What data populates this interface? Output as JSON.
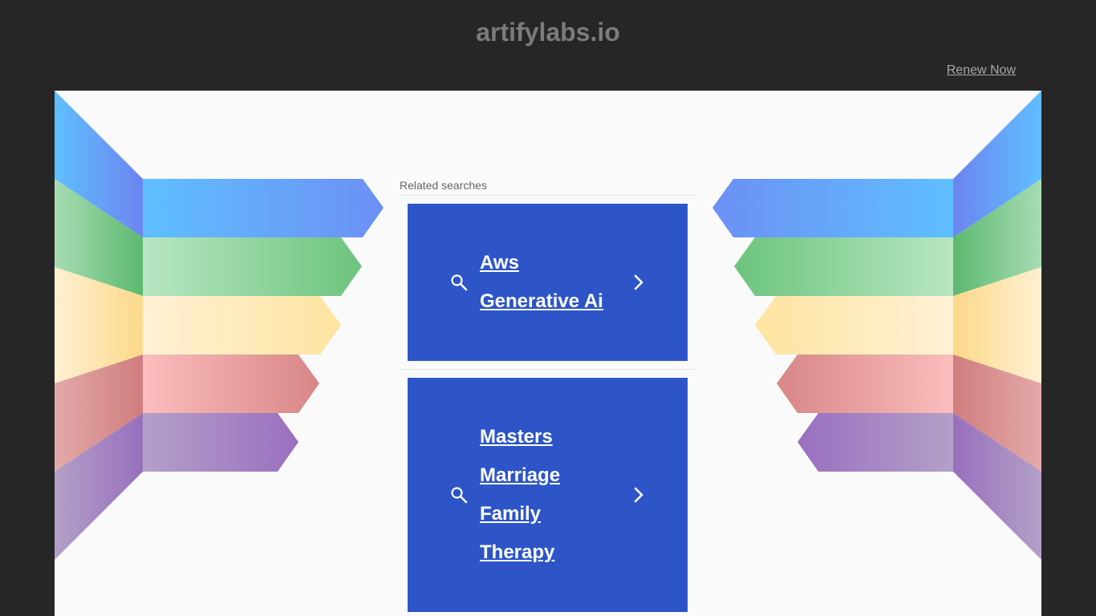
{
  "header": {
    "domain": "artifylabs.io",
    "renew_label": "Renew Now"
  },
  "related": {
    "title": "Related searches",
    "results": [
      {
        "lines": [
          "Aws",
          "Generative Ai"
        ]
      },
      {
        "lines": [
          "Masters",
          "Marriage",
          "Family",
          "Therapy"
        ]
      }
    ]
  },
  "icons": {
    "search": "search-icon",
    "chevron": "chevron-right-icon"
  },
  "colors": {
    "page_bg": "#262626",
    "panel_bg": "#fafafa",
    "result_bg": "#2d55c8",
    "title_text": "#7b7b7b",
    "blue_band": "#5fbfff",
    "green_band": "#6cc47d",
    "yellow_band": "#fee4a0",
    "red_band": "#e08d8d",
    "purple_band": "#9a6fc0"
  }
}
